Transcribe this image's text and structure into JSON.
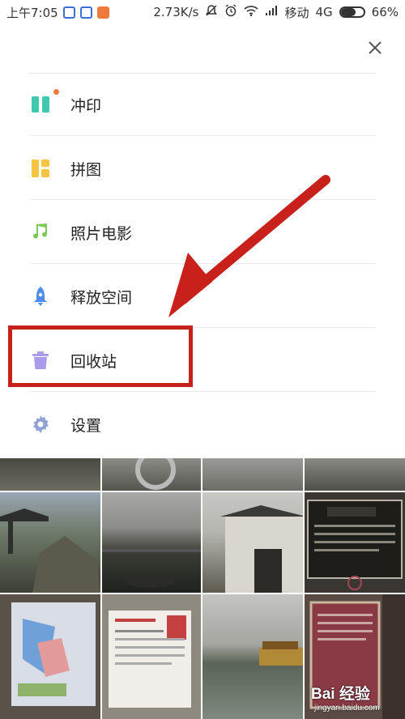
{
  "status_bar": {
    "time": "上午7:05",
    "speed": "2.73K/s",
    "carrier": "移动",
    "network": "4G",
    "battery": "66%",
    "battery_level": 0.66
  },
  "menu": {
    "items": [
      {
        "label": "冲印",
        "icon": "print-icon",
        "color": "#3ec9b0",
        "has_badge": true
      },
      {
        "label": "拼图",
        "icon": "collage-icon",
        "color": "#f5c542"
      },
      {
        "label": "照片电影",
        "icon": "music-note-icon",
        "color": "#7cc95a"
      },
      {
        "label": "释放空间",
        "icon": "rocket-icon",
        "color": "#4e8cf0"
      },
      {
        "label": "回收站",
        "icon": "trash-icon",
        "color": "#a99be8"
      },
      {
        "label": "设置",
        "icon": "gear-icon",
        "color": "#8fa1d6"
      }
    ]
  },
  "colors": {
    "annotation": "#c8201a",
    "badge": "#f07a3c"
  },
  "watermark": {
    "main": "Bai 经验",
    "sub": "jingyan.baidu.com"
  }
}
